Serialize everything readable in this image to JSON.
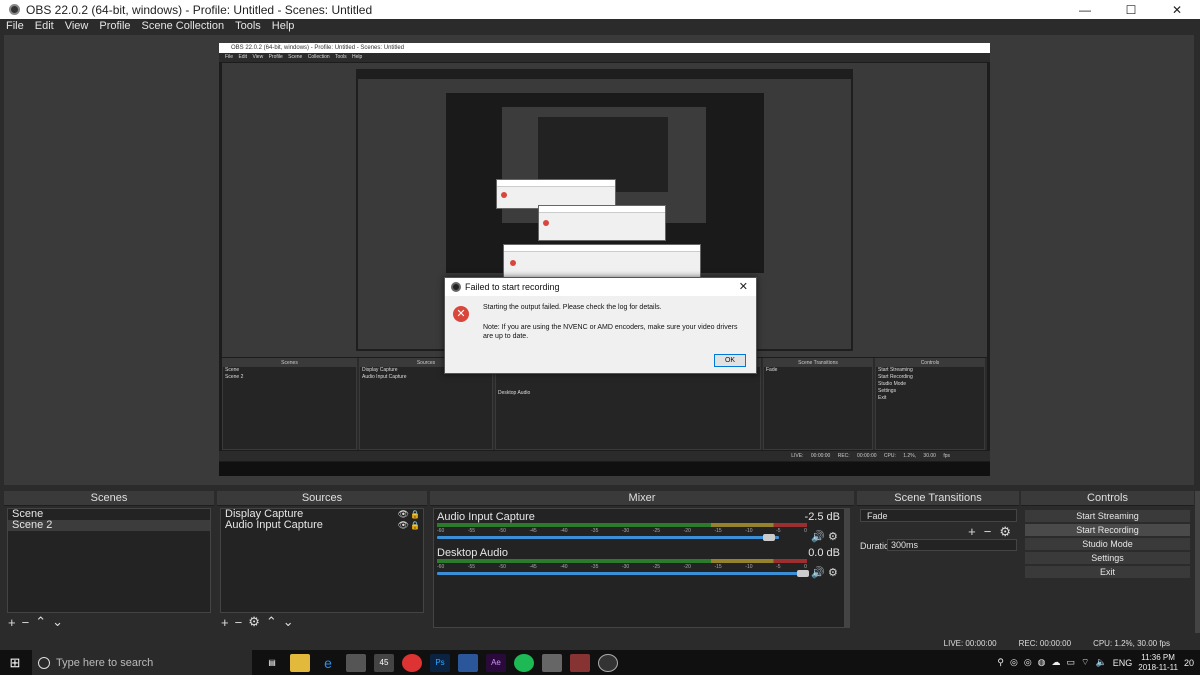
{
  "window": {
    "title": "OBS 22.0.2 (64-bit, windows) - Profile: Untitled - Scenes: Untitled",
    "minimize": "—",
    "maximize": "☐",
    "close": "✕"
  },
  "menu": [
    "File",
    "Edit",
    "View",
    "Profile",
    "Scene Collection",
    "Tools",
    "Help"
  ],
  "preview": {
    "nested_title": "OBS 22.0.2 (64-bit, windows) - Profile: Untitled - Scenes: Untitled",
    "nested_menu": "File Edit View Profile Scene Collection Tools Help",
    "nested_status": "LIVE: 00:00:00 REC: 00:00:00 CPU: 1.2%, 30.00 fps"
  },
  "dialog": {
    "title": "Failed to start recording",
    "close": "✕",
    "message": "Starting the output failed.  Please check the log for details.",
    "note": "Note: If you are using the NVENC or AMD encoders, make sure your video drivers are up to date.",
    "ok": "OK"
  },
  "scenes": {
    "header": "Scenes",
    "items": [
      "Scene",
      "Scene 2"
    ],
    "selected": "Scene 2"
  },
  "sources": {
    "header": "Sources",
    "items": [
      "Display Capture",
      "Audio Input Capture"
    ]
  },
  "mixer": {
    "header": "Mixer",
    "tracks": [
      {
        "name": "Audio Input Capture",
        "db": "-2.5 dB",
        "volume": 0.93
      },
      {
        "name": "Desktop Audio",
        "db": "0.0 dB",
        "volume": 1.0
      }
    ]
  },
  "transitions": {
    "header": "Scene Transitions",
    "selected": "Fade",
    "duration_label": "Duration",
    "duration_value": "300ms"
  },
  "controls": {
    "header": "Controls",
    "buttons": [
      "Start Streaming",
      "Start Recording",
      "Studio Mode",
      "Settings",
      "Exit"
    ]
  },
  "status": {
    "live": "LIVE: 00:00:00",
    "rec": "REC: 00:00:00",
    "cpu": "CPU: 1.2%, 30.00 fps"
  },
  "taskbar": {
    "search_placeholder": "Type here to search",
    "time": "11:36 PM",
    "date": "2018-11-11",
    "lang": "ENG",
    "notif": "20",
    "mail_badge": "45"
  }
}
